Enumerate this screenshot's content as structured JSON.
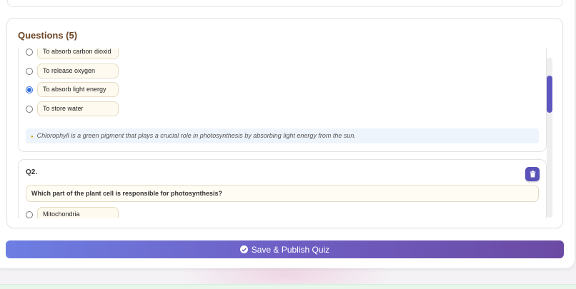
{
  "section": {
    "title": "Questions (5)"
  },
  "question1": {
    "options": [
      {
        "text": "To absorb carbon dioxid",
        "selected": false
      },
      {
        "text": "To release oxygen",
        "selected": false
      },
      {
        "text": "To absorb light energy",
        "selected": true
      },
      {
        "text": "To store water",
        "selected": false
      }
    ],
    "explanation": "Chlorophyll is a green pigment that plays a crucial role in photosynthesis by absorbing light energy from the sun."
  },
  "question2": {
    "number": "Q2.",
    "text": "Which part of the plant cell is responsible for photosynthesis?",
    "options": [
      {
        "text": "Mitochondria",
        "selected": false
      }
    ]
  },
  "actions": {
    "publish_label": "Save & Publish Quiz"
  },
  "icons": {
    "delete": "trash-icon",
    "publish": "check-circle-icon",
    "hint": "lightbulb-icon"
  },
  "colors": {
    "accent": "#5a52b8",
    "title": "#6b4424",
    "selected_radio": "#2f6fe0"
  }
}
